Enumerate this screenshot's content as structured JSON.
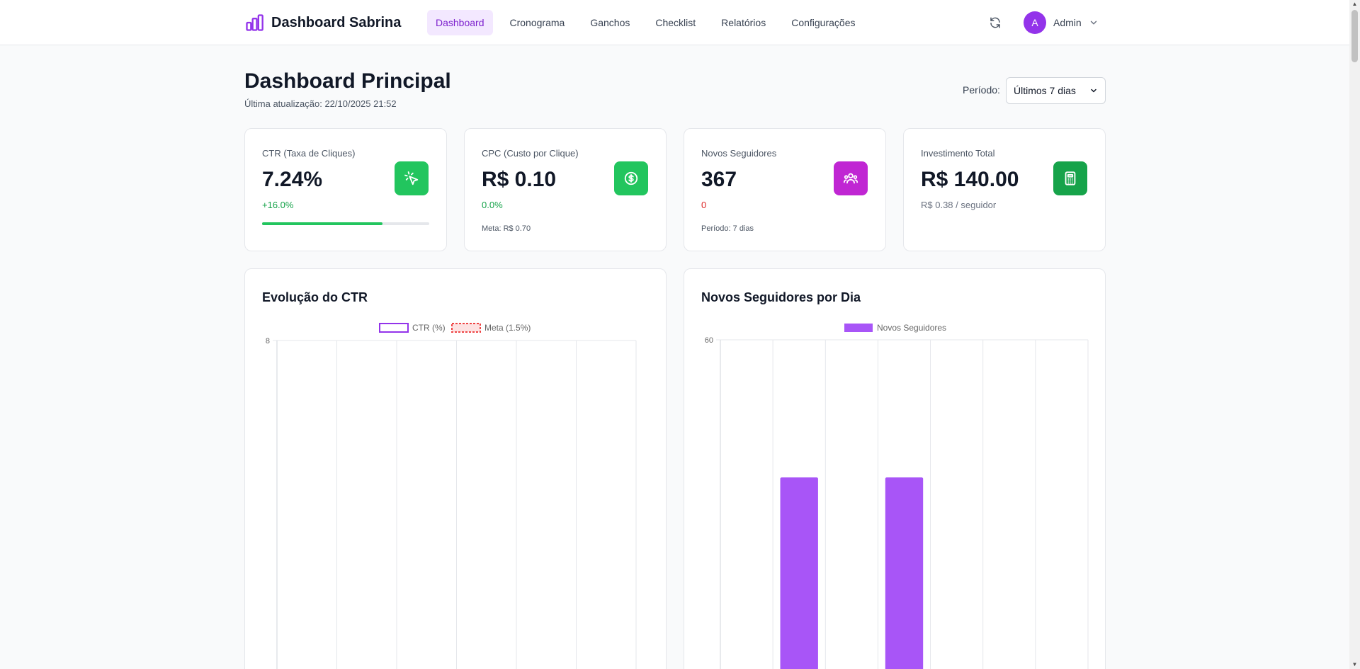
{
  "header": {
    "brand": "Dashboard Sabrina",
    "nav": [
      {
        "label": "Dashboard",
        "active": true
      },
      {
        "label": "Cronograma",
        "active": false
      },
      {
        "label": "Ganchos",
        "active": false
      },
      {
        "label": "Checklist",
        "active": false
      },
      {
        "label": "Relatórios",
        "active": false
      },
      {
        "label": "Configurações",
        "active": false
      }
    ],
    "user": {
      "initial": "A",
      "name": "Admin"
    }
  },
  "page": {
    "title": "Dashboard Principal",
    "last_update": "Última atualização: 22/10/2025 21:52",
    "period_label": "Período:",
    "period_value": "Últimos 7 dias"
  },
  "cards": [
    {
      "title": "CTR (Taxa de Cliques)",
      "value": "7.24%",
      "change": "+16.0%",
      "change_color": "#16a34a",
      "progress_percent": 72,
      "icon": "cursor-click-icon",
      "icon_color": "#22c55e"
    },
    {
      "title": "CPC (Custo por Clique)",
      "value": "R$ 0.10",
      "change": "0.0%",
      "change_color": "#16a34a",
      "footer": "Meta: R$ 0.70",
      "icon": "dollar-icon",
      "icon_color": "#22c55e"
    },
    {
      "title": "Novos Seguidores",
      "value": "367",
      "change": "0",
      "change_color": "#dc2626",
      "footer": "Período: 7 dias",
      "icon": "users-icon",
      "icon_color": "#c026d3"
    },
    {
      "title": "Investimento Total",
      "value": "R$ 140.00",
      "change": "R$ 0.38 / seguidor",
      "change_color": "#6b7280",
      "icon": "calculator-icon",
      "icon_color": "#16a34a"
    }
  ],
  "charts": {
    "ctr_title": "Evolução do CTR",
    "followers_title": "Novos Seguidores por Dia"
  },
  "chart_data": [
    {
      "type": "line",
      "title": "Evolução do CTR",
      "series": [
        {
          "name": "CTR (%)",
          "color": "#9333ea",
          "style": "outlined"
        },
        {
          "name": "Meta (1.5%)",
          "color": "#ef4444",
          "style": "dashed"
        }
      ],
      "y_ticks": [
        "8"
      ],
      "ylim_top": 8,
      "x_gridlines": 7
    },
    {
      "type": "bar",
      "title": "Novos Seguidores por Dia",
      "series": [
        {
          "name": "Novos Seguidores",
          "color": "#a855f7"
        }
      ],
      "y_ticks": [
        "60"
      ],
      "ylim_top": 60,
      "categories_count": 7,
      "visible_values": [
        null,
        36,
        null,
        36,
        null,
        null,
        null
      ],
      "value_note_unit": "approximate, axis top 60"
    }
  ]
}
